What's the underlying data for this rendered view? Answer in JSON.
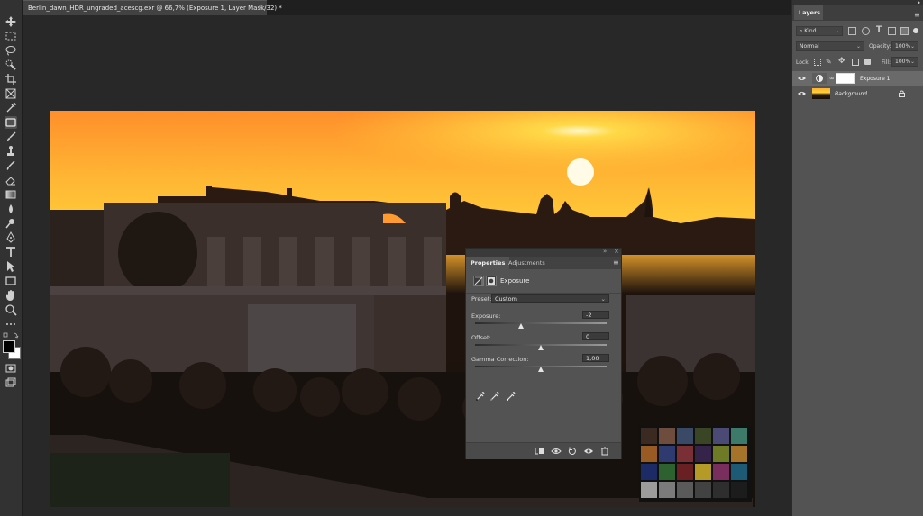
{
  "document": {
    "tab_title": "Berlin_dawn_HDR_ungraded_acescg.exr @ 66,7% (Exposure 1, Layer Mask/32) *",
    "close_glyph": "×"
  },
  "toolbar": {
    "tools": [
      "move-tool",
      "marquee-tool",
      "lasso-tool",
      "quick-selection-tool",
      "crop-tool",
      "frame-tool",
      "eyedropper-tool",
      "spot-healing-tool",
      "brush-tool",
      "clone-stamp-tool",
      "history-brush-tool",
      "eraser-tool",
      "gradient-tool",
      "blur-tool",
      "dodge-tool",
      "pen-tool",
      "type-tool",
      "path-selection-tool",
      "rectangle-tool",
      "hand-tool",
      "zoom-tool",
      "more-tools",
      "swap-colors",
      "quick-mask",
      "screen-mode"
    ],
    "active_tool": "frame-tool",
    "foreground_color": "#000000",
    "background_color": "#ffffff"
  },
  "properties": {
    "tabs": [
      "Properties",
      "Adjustments"
    ],
    "active_tab": "Properties",
    "adjustment_name": "Exposure",
    "preset_label": "Preset:",
    "preset_value": "Custom",
    "exposure_label": "Exposure:",
    "exposure_value": "-2",
    "exposure_fraction": 0.35,
    "offset_label": "Offset:",
    "offset_value": "0",
    "offset_fraction": 0.5,
    "gamma_label": "Gamma Correction:",
    "gamma_value": "1,00",
    "gamma_fraction": 0.5,
    "footer_buttons": [
      "clip-to-layer",
      "view-previous-state",
      "reset-adjustment",
      "toggle-visibility",
      "delete-adjustment"
    ]
  },
  "layers": {
    "tab_label": "Layers",
    "filter_kind": "Kind",
    "blend_mode": "Normal",
    "opacity_label": "Opacity:",
    "opacity_value": "100%",
    "lock_label": "Lock:",
    "fill_label": "Fill:",
    "fill_value": "100%",
    "items": [
      {
        "name": "Exposure 1",
        "selected": true,
        "type": "adjustment"
      },
      {
        "name": "Background",
        "selected": false,
        "type": "image",
        "locked": true
      }
    ]
  },
  "colors": {
    "panel_bg": "#535353",
    "app_bg": "#282828",
    "selected_layer": "#6a6a6a"
  }
}
